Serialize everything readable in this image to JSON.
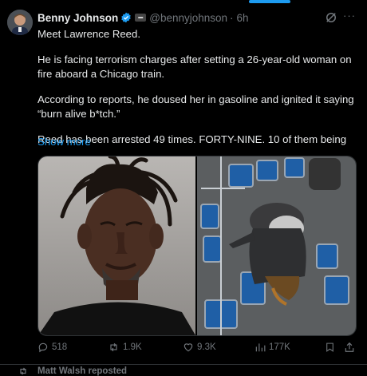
{
  "tweet": {
    "author_name": "Benny Johnson",
    "handle": "@bennyjohnson",
    "separator": "·",
    "time": "6h",
    "body": [
      "Meet Lawrence Reed.",
      "He is facing terrorism charges after setting a 26-year-old woman on fire aboard a Chicago train.",
      "According to reports, he doused her in gasoline and ignited it saying “burn alive b*tch.”",
      "Reed has been arrested 49 times. FORTY-NINE. 10 of them being"
    ],
    "show_more": "Show more",
    "media": [
      {
        "icon": "mugshot-photo"
      },
      {
        "icon": "train-surveillance-photo"
      }
    ],
    "actions": {
      "replies": "518",
      "reposts": "1.9K",
      "likes": "9.3K",
      "views": "177K"
    }
  },
  "next_item": {
    "repost_label": "Matt Walsh reposted"
  },
  "colors": {
    "background": "#000000",
    "text": "#e7e9ea",
    "muted": "#71767b",
    "accent": "#1d9bf0",
    "border": "#2f3336"
  }
}
